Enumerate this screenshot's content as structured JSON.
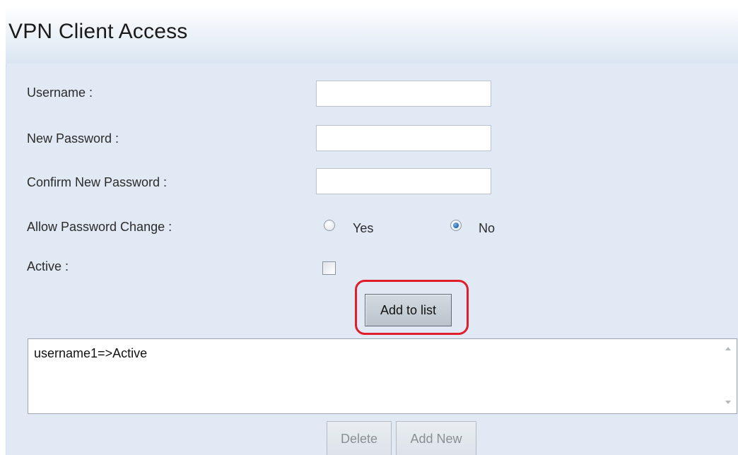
{
  "header": {
    "title": "VPN Client Access"
  },
  "form": {
    "username_label": "Username :",
    "username_value": "",
    "new_password_label": "New Password :",
    "new_password_value": "",
    "confirm_password_label": "Confirm New Password :",
    "confirm_password_value": "",
    "allow_change_label": "Allow Password Change :",
    "yes_label": "Yes",
    "no_label": "No",
    "allow_change_selected": "No",
    "active_label": "Active :",
    "active_checked": false,
    "add_button_label": "Add to list"
  },
  "list": {
    "items": [
      "username1=>Active"
    ]
  },
  "actions": {
    "delete_label": "Delete",
    "add_new_label": "Add New"
  },
  "colors": {
    "highlight": "#e01d2b",
    "panel_background": "#e1eaf4",
    "radio_selected": "#2c6fb7"
  }
}
